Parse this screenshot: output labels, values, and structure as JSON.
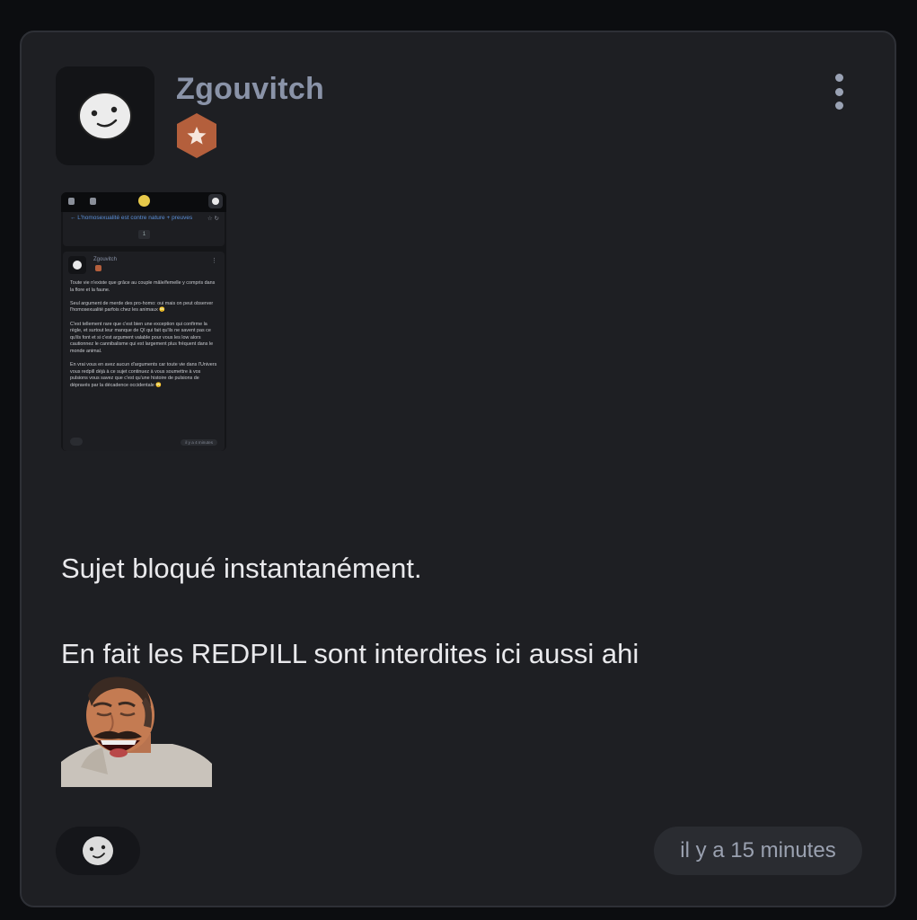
{
  "post": {
    "author": "Zgouvitch",
    "avatar_icon": "smile-face-icon",
    "badge_icon": "star-hexagon-icon",
    "badge_color": "#b45f3c",
    "menu_icon": "vertical-dots-icon",
    "message_line1": "Sujet bloqué instantanément.",
    "message_line2": "En fait les REDPILL sont interdites ici aussi ahi",
    "sticker": "risitas-laughing-sticker",
    "reaction_icon": "smile-face-icon",
    "timestamp": "il y a 15 minutes"
  },
  "attachment": {
    "topic_title": "← L'homosexualité est contre nature + preuves",
    "topic_icons": "☆ ↻",
    "page": "1",
    "author": "Zgouvitch",
    "more": "⋮",
    "text": "Toute vie n'existe que grâce au couple mâle/femelle y compris dans la flore et la faune.\n\nSeul argument de merde des pro-homo: oui mais on peut observer l'homosexualité parfois chez les animaux 🙄\n\nC'est tellement rare que c'est bien une exception qui confirme la règle, et surtout leur manque de QI qui fait qu'ils ne savent pas ce qu'ils font et si c'est argument valable pour vous les low alors cautionnez le cannibalisme qui est largement plus fréquent dans le monde animal.\n\nEn vrai vous en avez aucun d'arguments car toute vie dans l'Univers vous redpill déjà à ce sujet continuez à vous soumettre à vos pulsions vous savez que c'est qu'une histoire de pulsions de dépravés par la décadence occidentale 🙄",
    "time": "il y a 4 minutes"
  },
  "colors": {
    "background": "#0c0d10",
    "card": "#1e1f23",
    "username": "#8a93a8",
    "text": "#e9e9ec",
    "timestamp_pill": "#2a2c31"
  }
}
